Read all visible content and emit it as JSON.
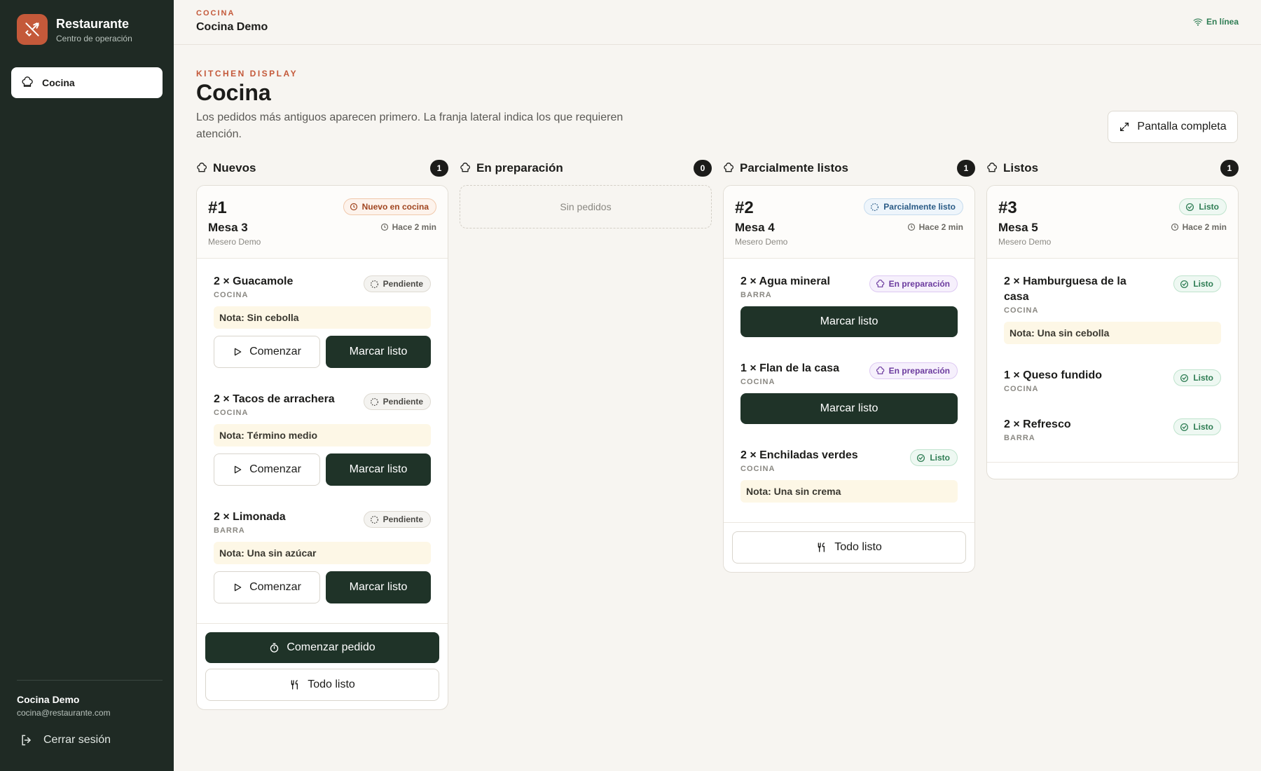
{
  "sidebar": {
    "brand_title": "Restaurante",
    "brand_subtitle": "Centro de operación",
    "nav": [
      {
        "label": "Cocina",
        "icon": "chef-hat-icon",
        "active": true
      }
    ],
    "user_name": "Cocina Demo",
    "user_email": "cocina@restaurante.com",
    "logout_label": "Cerrar sesión"
  },
  "topbar": {
    "kicker": "COCINA",
    "title": "Cocina Demo",
    "status": "En línea"
  },
  "header": {
    "kicker": "KITCHEN DISPLAY",
    "title": "Cocina",
    "description": "Los pedidos más antiguos aparecen primero. La franja lateral indica los que requieren atención.",
    "fullscreen_label": "Pantalla completa"
  },
  "columns": [
    {
      "title": "Nuevos",
      "count": "1"
    },
    {
      "title": "En preparación",
      "count": "0",
      "empty": "Sin pedidos"
    },
    {
      "title": "Parcialmente listos",
      "count": "1"
    },
    {
      "title": "Listos",
      "count": "1"
    }
  ],
  "orders": {
    "o1": {
      "number": "#1",
      "table": "Mesa 3",
      "waiter": "Mesero Demo",
      "status": "Nuevo en cocina",
      "time": "Hace 2 min",
      "items": [
        {
          "name": "2 × Guacamole",
          "station": "COCINA",
          "status": "Pendiente",
          "note": "Nota: Sin cebolla",
          "start": "Comenzar",
          "ready": "Marcar listo"
        },
        {
          "name": "2 × Tacos de arrachera",
          "station": "COCINA",
          "status": "Pendiente",
          "note": "Nota: Término medio",
          "start": "Comenzar",
          "ready": "Marcar listo"
        },
        {
          "name": "2 × Limonada",
          "station": "BARRA",
          "status": "Pendiente",
          "note": "Nota: Una sin azúcar",
          "start": "Comenzar",
          "ready": "Marcar listo"
        }
      ],
      "start_order": "Comenzar pedido",
      "all_ready": "Todo listo"
    },
    "o2": {
      "number": "#2",
      "table": "Mesa 4",
      "waiter": "Mesero Demo",
      "status": "Parcialmente listo",
      "time": "Hace 2 min",
      "items": [
        {
          "name": "2 × Agua mineral",
          "station": "BARRA",
          "status": "En preparación",
          "ready": "Marcar listo"
        },
        {
          "name": "1 × Flan de la casa",
          "station": "COCINA",
          "status": "En preparación",
          "ready": "Marcar listo"
        },
        {
          "name": "2 × Enchiladas verdes",
          "station": "COCINA",
          "status": "Listo",
          "note": "Nota: Una sin crema"
        }
      ],
      "all_ready": "Todo listo"
    },
    "o3": {
      "number": "#3",
      "table": "Mesa 5",
      "waiter": "Mesero Demo",
      "status": "Listo",
      "time": "Hace 2 min",
      "items": [
        {
          "name": "2 × Hamburguesa de la casa",
          "station": "COCINA",
          "status": "Listo",
          "note": "Nota: Una sin cebolla"
        },
        {
          "name": "1 × Queso fundido",
          "station": "COCINA",
          "status": "Listo"
        },
        {
          "name": "2 × Refresco",
          "station": "BARRA",
          "status": "Listo"
        }
      ]
    }
  }
}
